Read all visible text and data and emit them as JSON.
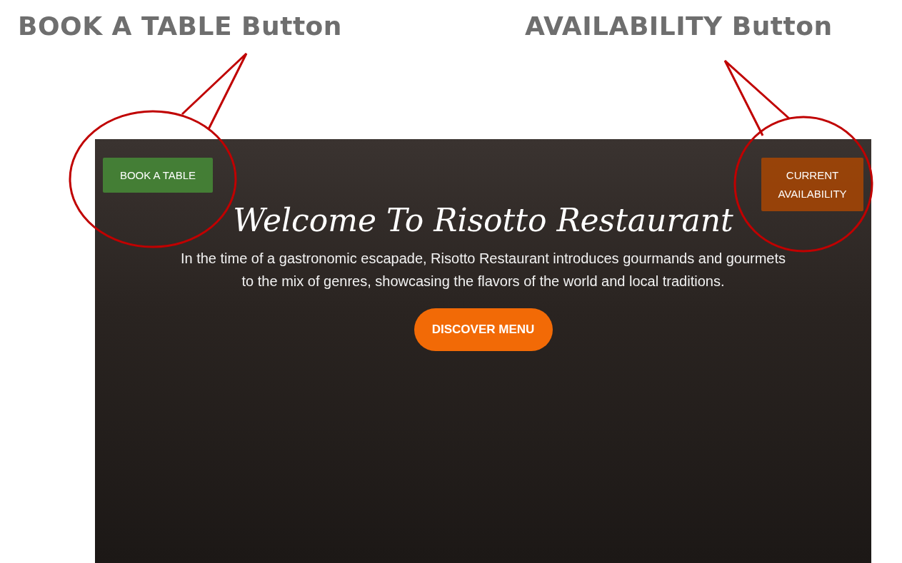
{
  "annotations": [
    {
      "text": "BOOK A TABLE Button"
    },
    {
      "text": "AVAILABILITY Button"
    }
  ],
  "hero": {
    "book_button": "BOOK A TABLE",
    "availability_button": "CURRENT AVAILABILITY",
    "title": "Welcome To Risotto Restaurant",
    "description": "In the time of a gastronomic escapade, Risotto Restaurant introduces gourmands and gourmets to the mix of genres, showcasing the flavors of the world and local traditions.",
    "cta": "DISCOVER MENU"
  }
}
